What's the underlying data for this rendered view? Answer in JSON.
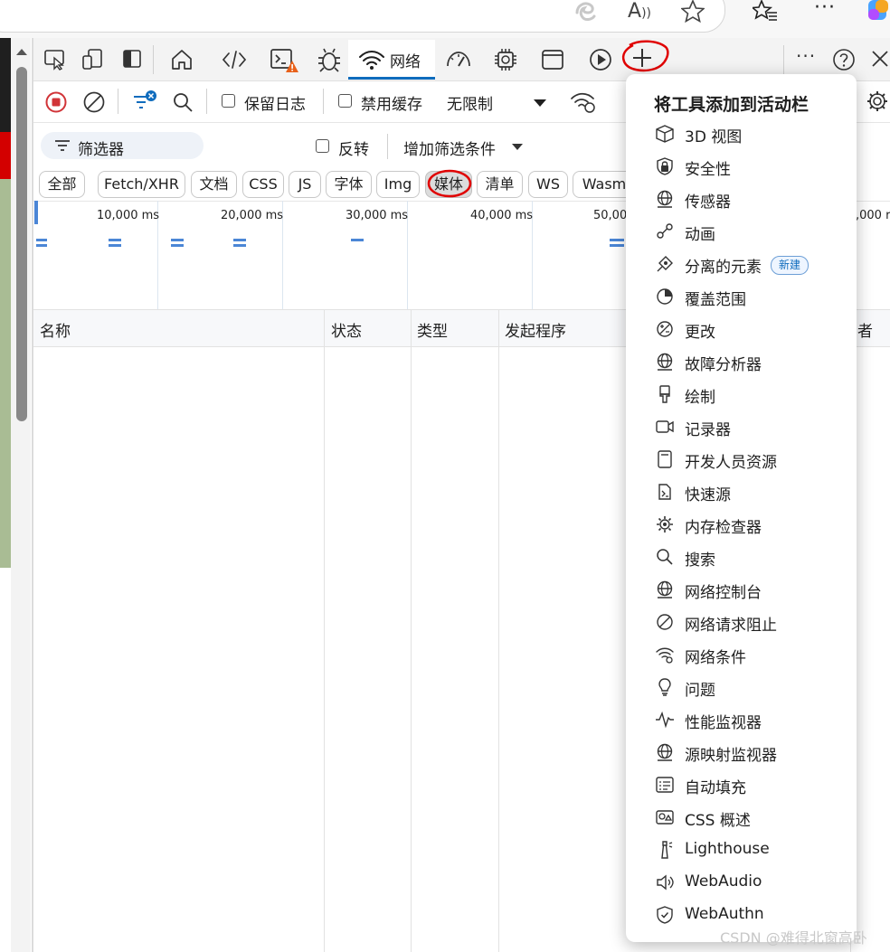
{
  "devtools": {
    "active_tab_label": "网络"
  },
  "toolbar": {
    "preserve_log": "保留日志",
    "disable_cache": "禁用缓存",
    "throttling": "无限制"
  },
  "filter": {
    "placeholder": "筛选器",
    "invert": "反转",
    "more_filters": "增加筛选条件"
  },
  "type_chips": [
    {
      "label": "全部"
    },
    {
      "label": "Fetch/XHR"
    },
    {
      "label": "文档"
    },
    {
      "label": "CSS"
    },
    {
      "label": "JS"
    },
    {
      "label": "字体"
    },
    {
      "label": "Img"
    },
    {
      "label": "媒体",
      "selected": true
    },
    {
      "label": "清单"
    },
    {
      "label": "WS"
    },
    {
      "label": "Wasm"
    }
  ],
  "overview": {
    "ticks": [
      "10,000 ms",
      "20,000 ms",
      "30,000 ms",
      "40,000 ms",
      "50,00",
      ",000 r"
    ]
  },
  "table": {
    "columns": [
      "名称",
      "状态",
      "类型",
      "发起程序",
      "者"
    ]
  },
  "add_tool_menu": {
    "title": "将工具添加到活动栏",
    "new_badge": "新建",
    "items": [
      {
        "label": "3D 视图",
        "icon": "cube-icon"
      },
      {
        "label": "安全性",
        "icon": "lock-shield-icon"
      },
      {
        "label": "传感器",
        "icon": "globe-icon"
      },
      {
        "label": "动画",
        "icon": "animation-icon"
      },
      {
        "label": "分离的元素",
        "icon": "detached-icon",
        "badge": true
      },
      {
        "label": "覆盖范围",
        "icon": "pie-icon"
      },
      {
        "label": "更改",
        "icon": "changes-icon"
      },
      {
        "label": "故障分析器",
        "icon": "globe-icon"
      },
      {
        "label": "绘制",
        "icon": "paint-brush-icon"
      },
      {
        "label": "记录器",
        "icon": "video-icon"
      },
      {
        "label": "开发人员资源",
        "icon": "document-icon"
      },
      {
        "label": "快速源",
        "icon": "quick-source-icon"
      },
      {
        "label": "内存检查器",
        "icon": "memory-gear-icon"
      },
      {
        "label": "搜索",
        "icon": "search-icon"
      },
      {
        "label": "网络控制台",
        "icon": "globe-icon"
      },
      {
        "label": "网络请求阻止",
        "icon": "block-icon"
      },
      {
        "label": "网络条件",
        "icon": "wifi-gear-icon"
      },
      {
        "label": "问题",
        "icon": "lightbulb-icon"
      },
      {
        "label": "性能监视器",
        "icon": "pulse-icon"
      },
      {
        "label": "源映射监视器",
        "icon": "globe-icon"
      },
      {
        "label": "自动填充",
        "icon": "form-icon"
      },
      {
        "label": "CSS 概述",
        "icon": "css-overview-icon"
      },
      {
        "label": "Lighthouse",
        "icon": "lighthouse-icon"
      },
      {
        "label": "WebAudio",
        "icon": "speaker-icon"
      },
      {
        "label": "WebAuthn",
        "icon": "shield-check-icon"
      }
    ]
  },
  "watermark": "CSDN @难得北窗高卧",
  "colors": {
    "accent": "#0f6cbd",
    "annotation_red": "#e00000",
    "record_red": "#d13438"
  }
}
